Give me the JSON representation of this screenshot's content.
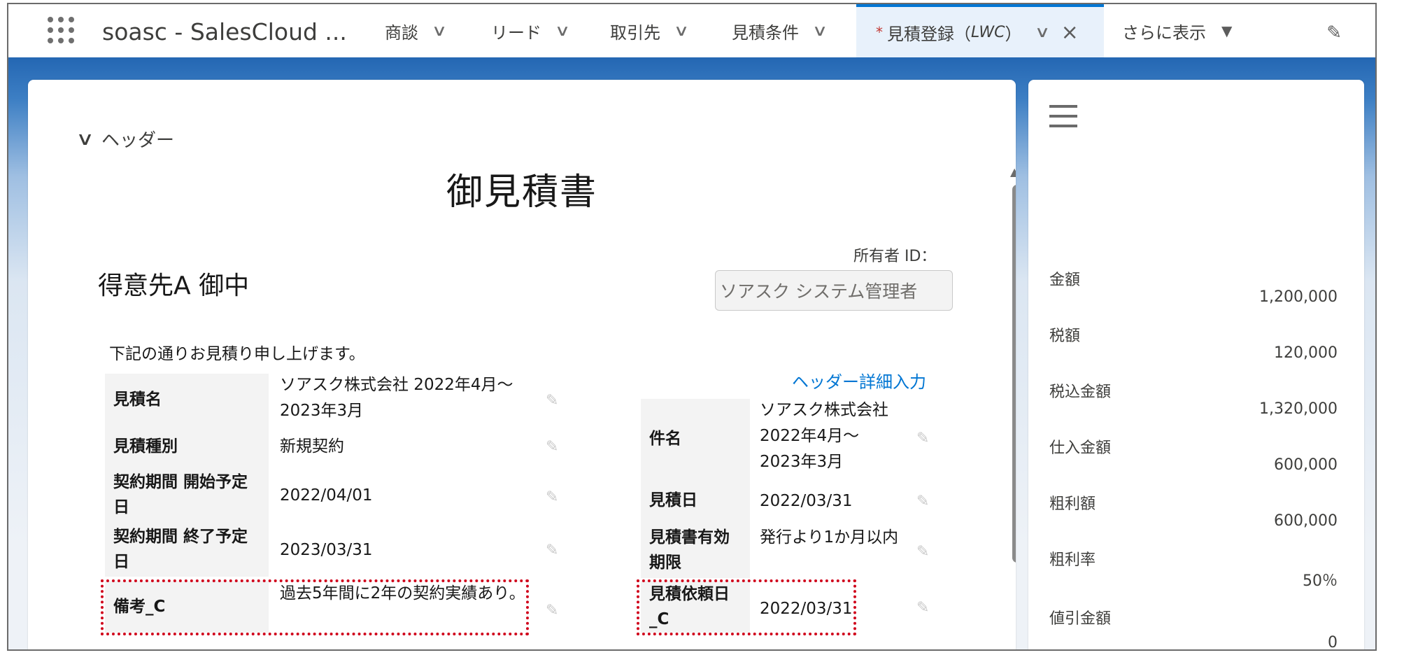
{
  "nav": {
    "app_name": "soasc - SalesCloud ...",
    "tabs": [
      {
        "label": "商談"
      },
      {
        "label": "リード"
      },
      {
        "label": "取引先"
      },
      {
        "label": "見積条件"
      }
    ],
    "active_tab": {
      "prefix": "*",
      "label": "見積登録（",
      "italic": "LWC",
      "suffix": "）"
    },
    "more_label": "さらに表示"
  },
  "header_section": {
    "toggle_label": "ヘッダー",
    "doc_title": "御見積書",
    "customer": "得意先A 御中",
    "owner_label": "所有者 ID：",
    "owner_value": "ソアスク システム管理者",
    "intro": "下記の通りお見積り申し上げます。",
    "detail_link": "ヘッダー詳細入力"
  },
  "left_fields": [
    {
      "label": "見積名",
      "value": "ソアスク株式会社 2022年4月～\n2023年3月"
    },
    {
      "label": "見積種別",
      "value": "新規契約"
    },
    {
      "label": "契約期間 開始予定日",
      "value": "2022/04/01"
    },
    {
      "label": "契約期間 終了予定日",
      "value": "2023/03/31"
    },
    {
      "label": "備考_C",
      "value": "過去5年間に2年の契約実績あり。"
    }
  ],
  "right_fields": [
    {
      "label": "件名",
      "value": "ソアスク株式会社 2022年4月～2023年3月"
    },
    {
      "label": "見積日",
      "value": "2022/03/31"
    },
    {
      "label": "見積書有効期限",
      "value": "発行より1か月以内"
    },
    {
      "label": "見積依頼日_C",
      "value": "2022/03/31"
    }
  ],
  "summary": [
    {
      "label": "金額",
      "value": "1,200,000"
    },
    {
      "label": "税額",
      "value": "120,000"
    },
    {
      "label": "税込金額",
      "value": "1,320,000"
    },
    {
      "label": "仕入金額",
      "value": "600,000"
    },
    {
      "label": "粗利額",
      "value": "600,000"
    },
    {
      "label": "粗利率",
      "value": "50％"
    },
    {
      "label": "値引金額",
      "value": "0"
    }
  ],
  "colors": {
    "brand_blue": "#0176d3",
    "highlight_red": "#d0021b"
  }
}
